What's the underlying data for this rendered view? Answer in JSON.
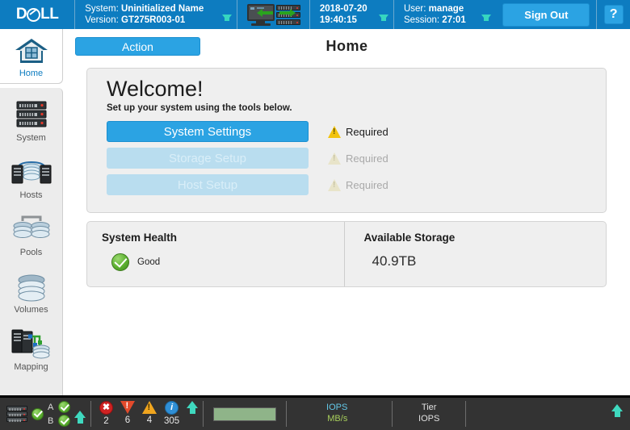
{
  "header": {
    "logo_text": "DELL",
    "system_label": "System:",
    "system_value": "Uninitialized Name",
    "version_label": "Version:",
    "version_value": "GT275R003-01",
    "date": "2018-07-20",
    "time": "19:40:15",
    "user_label": "User:",
    "user_value": "manage",
    "session_label": "Session:",
    "session_value": "27:01",
    "sign_out": "Sign Out",
    "help": "?",
    "bg_color": "#0d7cc0",
    "button_color": "#2ba3e3"
  },
  "sidebar": {
    "items": [
      {
        "label": "Home",
        "icon": "house-icon",
        "active": true
      },
      {
        "label": "System",
        "icon": "server-rack-icon",
        "active": false
      },
      {
        "label": "Hosts",
        "icon": "hosts-icon",
        "active": false
      },
      {
        "label": "Pools",
        "icon": "pools-icon",
        "active": false
      },
      {
        "label": "Volumes",
        "icon": "volumes-icon",
        "active": false
      },
      {
        "label": "Mapping",
        "icon": "mapping-icon",
        "active": false
      },
      {
        "label": "",
        "icon": "replication-icon",
        "active": false
      }
    ]
  },
  "main": {
    "action_button": "Action",
    "page_title": "Home",
    "welcome": {
      "title": "Welcome!",
      "subtitle": "Set up your system using the tools below.",
      "setup_items": [
        {
          "label": "System Settings",
          "status": "Required",
          "enabled": true
        },
        {
          "label": "Storage Setup",
          "status": "Required",
          "enabled": false
        },
        {
          "label": "Host Setup",
          "status": "Required",
          "enabled": false
        }
      ]
    },
    "status": {
      "health_heading": "System Health",
      "health_value": "Good",
      "health_icon": "check-circle-icon",
      "storage_heading": "Available Storage",
      "storage_value": "40.9TB"
    }
  },
  "statusbar": {
    "controllers": [
      {
        "label": "A",
        "state": "ok"
      },
      {
        "label": "B",
        "state": "ok"
      }
    ],
    "alerts": [
      {
        "icon": "error-icon",
        "count": "2"
      },
      {
        "icon": "critical-icon",
        "count": "6"
      },
      {
        "icon": "warning-icon",
        "count": "4"
      },
      {
        "icon": "info-icon",
        "count": "305"
      }
    ],
    "performance": {
      "iops": "IOPS",
      "mbs": "MB/s"
    },
    "tier": {
      "line1": "Tier",
      "line2": "IOPS"
    }
  }
}
